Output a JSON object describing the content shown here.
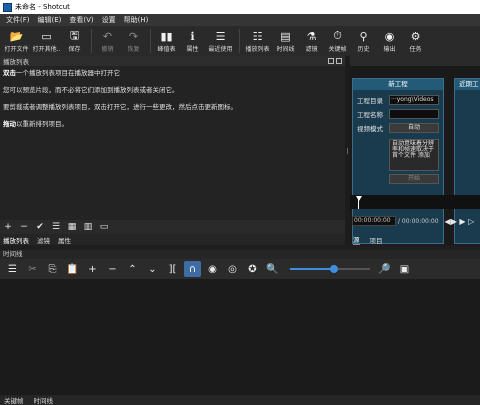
{
  "window": {
    "title": "未命名 - Shotcut"
  },
  "menu": [
    "文件(F)",
    "编辑(E)",
    "查看(V)",
    "设置",
    "帮助(H)"
  ],
  "toolbar": {
    "items": [
      {
        "label": "打开文件",
        "icon": "folder-open-icon",
        "glyph": "📂",
        "disabled": false
      },
      {
        "label": "打开其他..",
        "icon": "open-other-icon",
        "glyph": "▭",
        "disabled": false
      },
      {
        "label": "保存",
        "icon": "save-icon",
        "glyph": "🖫",
        "disabled": false
      },
      {
        "label": "撤销",
        "icon": "undo-icon",
        "glyph": "↶",
        "disabled": true
      },
      {
        "label": "恢复",
        "icon": "redo-icon",
        "glyph": "↷",
        "disabled": true
      },
      {
        "label": "峰值表",
        "icon": "peak-meter-icon",
        "glyph": "▮▮",
        "disabled": false
      },
      {
        "label": "属性",
        "icon": "properties-icon",
        "glyph": "ℹ",
        "disabled": false
      },
      {
        "label": "最近使用",
        "icon": "recent-icon",
        "glyph": "☰",
        "disabled": false
      },
      {
        "label": "播放列表",
        "icon": "playlist-icon",
        "glyph": "☷",
        "disabled": false
      },
      {
        "label": "时间线",
        "icon": "timeline-icon",
        "glyph": "▤",
        "disabled": false
      },
      {
        "label": "滤镜",
        "icon": "filters-icon",
        "glyph": "⚗",
        "disabled": false
      },
      {
        "label": "关键帧",
        "icon": "keyframes-icon",
        "glyph": "⏱",
        "disabled": false
      },
      {
        "label": "历史",
        "icon": "history-icon",
        "glyph": "⚲",
        "disabled": false
      },
      {
        "label": "输出",
        "icon": "export-icon",
        "glyph": "◉",
        "disabled": false
      },
      {
        "label": "任务",
        "icon": "jobs-icon",
        "glyph": "⚙",
        "disabled": false
      }
    ]
  },
  "playlist": {
    "title": "播放列表",
    "hints": [
      {
        "bold": "双击",
        "text": "一个播放列表项目在播放器中打开它"
      },
      {
        "bold": "",
        "text": "您可以预览片段，而不必将它们添加到播放列表或者关闭它。"
      },
      {
        "bold": "",
        "text": "要剪裁或者调整播放列表项目，双击打开它，进行一些更改，然后点击更新图标。"
      },
      {
        "bold": "拖动",
        "text": "以重新排列项目。"
      }
    ],
    "tools": [
      "+",
      "−",
      "✔",
      "☰",
      "▦",
      "▥",
      "▭"
    ],
    "tool_names": [
      "add-icon",
      "remove-icon",
      "update-icon",
      "view-details-icon",
      "view-tiles-icon",
      "view-icons-icon",
      "menu-icon"
    ],
    "tabs": [
      "播放列表",
      "滤镜",
      "属性"
    ]
  },
  "new_project": {
    "title": "新工程",
    "dir_label": "工程目录",
    "dir_value": "···yong\\Videos",
    "name_label": "工程名称",
    "name_value": "",
    "mode_label": "视频模式",
    "mode_value": "自动",
    "list_text": "自动意味着分辨率和帧速取决于 首个文件 添加",
    "start_button": "开始"
  },
  "recent_panel": {
    "title": "近期工"
  },
  "player": {
    "timecode_current": "00:00:00:00",
    "timecode_total": "/ 00:00:00:00",
    "timecode_in": "00:00:00",
    "transport": "◀▶ ▶ ▷",
    "tabs": [
      "源",
      "项目"
    ]
  },
  "timeline": {
    "title": "时间线",
    "tools": [
      {
        "glyph": "☰",
        "name": "menu-icon",
        "dim": false
      },
      {
        "glyph": "✂",
        "name": "cut-icon",
        "dim": true
      },
      {
        "glyph": "⎘",
        "name": "copy-icon",
        "dim": false
      },
      {
        "glyph": "📋",
        "name": "paste-icon",
        "dim": false
      },
      {
        "glyph": "+",
        "name": "append-icon",
        "dim": false
      },
      {
        "glyph": "−",
        "name": "remove-icon",
        "dim": false
      },
      {
        "glyph": "⌃",
        "name": "lift-icon",
        "dim": false
      },
      {
        "glyph": "⌄",
        "name": "overwrite-icon",
        "dim": false
      },
      {
        "glyph": "][",
        "name": "split-icon",
        "dim": false
      },
      {
        "glyph": "∩",
        "name": "snap-icon",
        "dim": false,
        "active": true
      },
      {
        "glyph": "◉",
        "name": "scrub-icon",
        "dim": false
      },
      {
        "glyph": "◎",
        "name": "ripple-icon",
        "dim": false
      },
      {
        "glyph": "✪",
        "name": "ripple-all-icon",
        "dim": false
      },
      {
        "glyph": "🔍",
        "name": "zoom-out-icon",
        "dim": false
      }
    ],
    "zoom_fraction": 0.55,
    "tools_right": [
      {
        "glyph": "🔎",
        "name": "zoom-in-icon"
      },
      {
        "glyph": "▣",
        "name": "zoom-fit-icon"
      }
    ]
  },
  "bottom_tabs": [
    "关键帧",
    "时间线"
  ]
}
